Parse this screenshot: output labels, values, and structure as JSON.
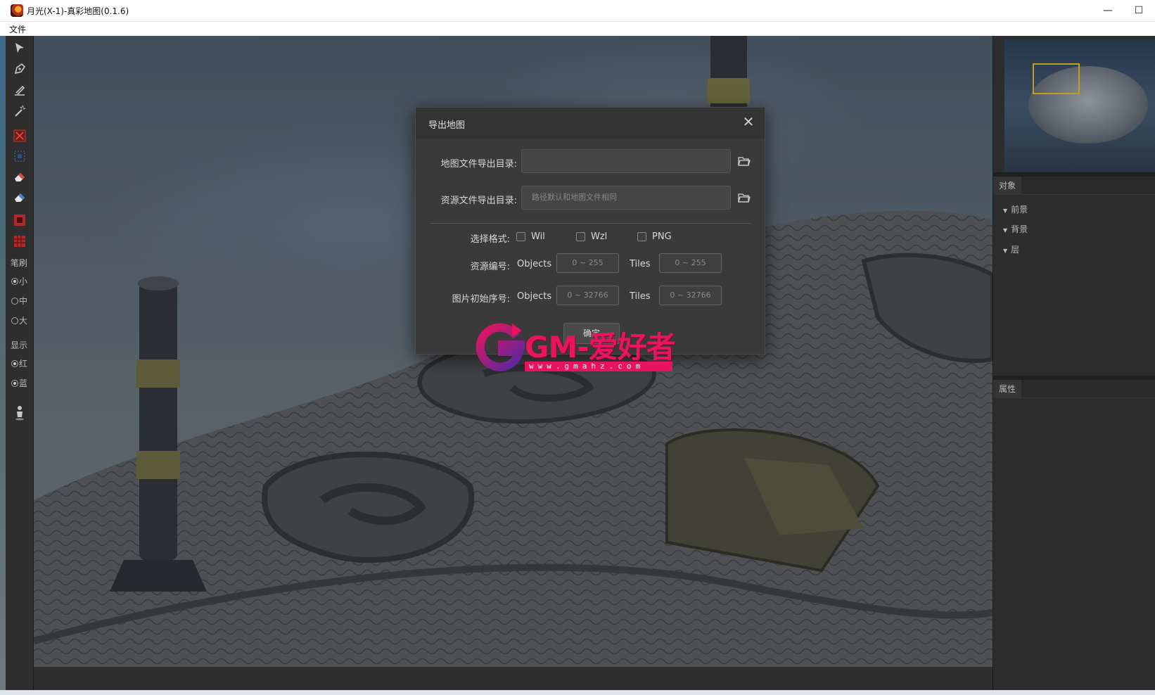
{
  "window": {
    "title": "月光(X-1)-真彩地图(0.1.6)",
    "minimize": "—",
    "maximize": "☐"
  },
  "menu": {
    "file": "文件"
  },
  "toolbar": {
    "brush_label": "笔刷",
    "brush_small": "小",
    "brush_medium": "中",
    "brush_large": "大",
    "display_label": "显示",
    "display_red": "红",
    "display_blue": "蓝"
  },
  "objects_panel": {
    "title": "对象",
    "items": [
      {
        "label": "前景"
      },
      {
        "label": "背景"
      },
      {
        "label": "层"
      }
    ]
  },
  "properties_panel": {
    "title": "属性"
  },
  "dialog": {
    "title": "导出地图",
    "map_dir_label": "地图文件导出目录:",
    "map_dir_value": "",
    "res_dir_label": "资源文件导出目录:",
    "res_dir_placeholder": "路径默认和地图文件相同",
    "format_label": "选择格式:",
    "formats": [
      {
        "label": "Wil",
        "checked": false
      },
      {
        "label": "Wzl",
        "checked": false
      },
      {
        "label": "PNG",
        "checked": false
      }
    ],
    "res_num_label": "资源编号:",
    "objects_label": "Objects",
    "tiles_label": "Tiles",
    "res_objects_placeholder": "0 ~ 255",
    "res_tiles_placeholder": "0 ~ 255",
    "img_start_label": "图片初始序号:",
    "img_objects_placeholder": "0 ~ 32766",
    "img_tiles_placeholder": "0 ~ 32766",
    "confirm_label": "确定"
  },
  "watermark": {
    "text": "GM-爱好者",
    "url": "www.gmahz.com"
  },
  "colors": {
    "accent_red": "#e8145d",
    "minimap_frame": "#c39d1f"
  }
}
